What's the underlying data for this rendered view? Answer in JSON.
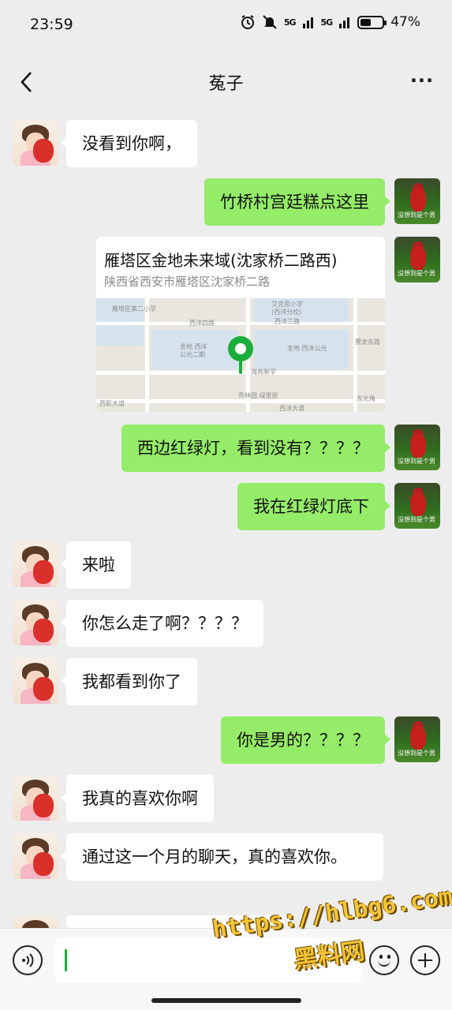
{
  "status": {
    "time": "23:59",
    "signal1": "5G",
    "signal2": "5G",
    "battery_pct": "47%",
    "alarm_icon": "alarm-icon",
    "mute_icon": "mute-icon"
  },
  "nav": {
    "title": "菟子",
    "back_icon": "chevron-left-icon",
    "more_icon": "more-icon"
  },
  "messages": [
    {
      "side": "in",
      "text": "没看到你啊，"
    },
    {
      "side": "out",
      "text": "竹桥村宫廷糕点这里"
    },
    {
      "side": "out",
      "type": "location"
    },
    {
      "side": "out",
      "text": "西边红绿灯，看到没有？？？？"
    },
    {
      "side": "out",
      "text": "我在红绿灯底下"
    },
    {
      "side": "in",
      "text": "来啦"
    },
    {
      "side": "in",
      "text": "你怎么走了啊？？？？"
    },
    {
      "side": "in",
      "text": "我都看到你了"
    },
    {
      "side": "out",
      "text": "你是男的？？？？"
    },
    {
      "side": "in",
      "text": "我真的喜欢你啊"
    },
    {
      "side": "in",
      "text": "通过这一个月的聊天，真的喜欢你。"
    }
  ],
  "location": {
    "title": "雁塔区金地未来域(沈家桥二路西)",
    "address": "陕西省西安市雁塔区沈家桥二路",
    "map_labels": [
      "雁塔区第二小学",
      "西沣四路",
      "艾克思小学",
      "(西沣分校)",
      "西沣三路",
      "金地 西沣",
      "公元二期",
      "金地 西沣公元",
      "海亮新学",
      "乔林园 绿里居",
      "西影大道",
      "西沣大道",
      "东北角",
      "赛龙东路"
    ]
  },
  "avatar": {
    "right_caption": "没想到是个男"
  },
  "input": {
    "voice_icon": "voice-icon",
    "emoji_icon": "emoji-icon",
    "plus_icon": "plus-icon"
  },
  "watermark": {
    "line1": "https://hlbg6.com",
    "line2": "黑料网"
  }
}
